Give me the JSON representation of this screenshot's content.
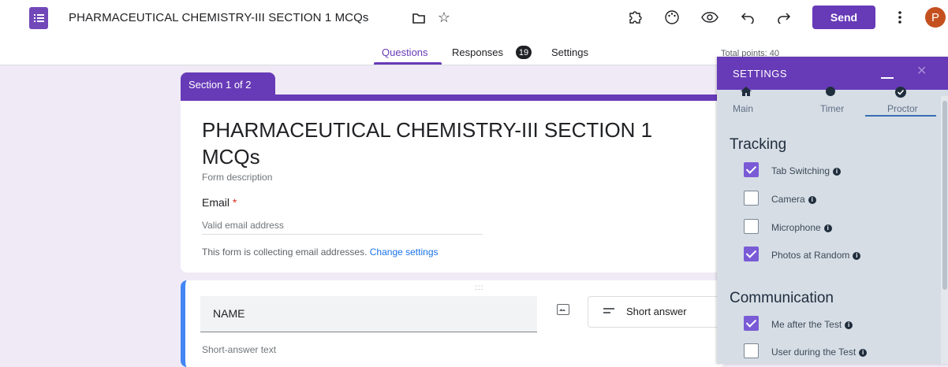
{
  "header": {
    "title": "PHARMACEUTICAL CHEMISTRY-III SECTION 1 MCQs",
    "send_label": "Send",
    "avatar_letter": "P"
  },
  "tabs": [
    {
      "label": "Questions",
      "active": true
    },
    {
      "label": "Responses",
      "badge": "19"
    },
    {
      "label": "Settings"
    }
  ],
  "total_points": "Total points: 40",
  "section": {
    "label": "Section 1 of 2"
  },
  "form": {
    "title": "PHARMACEUTICAL CHEMISTRY-III SECTION 1 MCQs",
    "description": "Form description",
    "email_label": "Email",
    "email_required": "*",
    "email_placeholder": "Valid email address",
    "collecting_text": "This form is collecting email addresses.",
    "change_settings_link": "Change settings"
  },
  "question": {
    "drag_handle": ":::",
    "title": "NAME",
    "type": "Short answer",
    "answer_placeholder": "Short-answer text"
  },
  "settings_panel": {
    "title": "SETTINGS",
    "tabs": [
      {
        "label": "Main",
        "icon": "home-icon"
      },
      {
        "label": "Timer",
        "icon": "info-icon"
      },
      {
        "label": "Proctor",
        "icon": "check-circle-icon",
        "active": true
      }
    ],
    "tracking": {
      "heading": "Tracking",
      "items": [
        {
          "label": "Tab Switching",
          "checked": true
        },
        {
          "label": "Camera",
          "checked": false
        },
        {
          "label": "Microphone",
          "checked": false
        },
        {
          "label": "Photos at Random",
          "checked": true
        }
      ]
    },
    "communication": {
      "heading": "Communication",
      "items": [
        {
          "label": "Me after the Test",
          "checked": true
        },
        {
          "label": "User during the Test",
          "checked": false
        }
      ]
    }
  },
  "colors": {
    "accent": "#673ab7",
    "question_border": "#4285f4",
    "panel_bg": "#d6dde5"
  }
}
